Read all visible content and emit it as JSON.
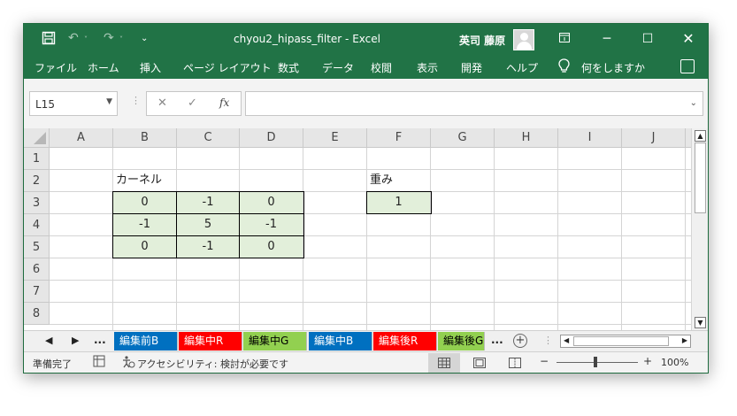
{
  "window": {
    "title": "chyou2_hipass_filter  -  Excel",
    "user": "英司 藤原",
    "accent": "#217346"
  },
  "titlebar_icons": {
    "save": "save-icon",
    "undo": "undo-icon",
    "redo": "redo-icon",
    "customize": "customize-qat-icon",
    "ribbon_display": "ribbon-display-icon",
    "minimize": "minimize-icon",
    "maximize": "maximize-icon",
    "close": "close-icon"
  },
  "menu": {
    "items": [
      "ファイル",
      "ホーム",
      "挿入",
      "ページ レイアウト",
      "数式",
      "データ",
      "校閲",
      "表示",
      "開発",
      "ヘルプ"
    ],
    "tell_me": "何をしますか"
  },
  "formula_bar": {
    "name_box": "L15",
    "cancel": "✕",
    "enter": "✓",
    "fx": "fx",
    "value": ""
  },
  "grid": {
    "columns": [
      "A",
      "B",
      "C",
      "D",
      "E",
      "F",
      "G",
      "H",
      "I",
      "J"
    ],
    "rows": [
      "1",
      "2",
      "3",
      "4",
      "5",
      "6",
      "7",
      "8"
    ],
    "kernel_label": "カーネル",
    "weight_label": "重み",
    "kernel": [
      [
        "0",
        "-1",
        "0"
      ],
      [
        "-1",
        "5",
        "-1"
      ],
      [
        "0",
        "-1",
        "0"
      ]
    ],
    "weight": "1",
    "highlight_color": "#e2efda"
  },
  "sheets": {
    "nav_prev": "◀",
    "nav_next": "▶",
    "more_left": "...",
    "more_right": "...",
    "tabs": [
      {
        "label": "編集前B",
        "color": "#0070c0",
        "text": "#ffffff"
      },
      {
        "label": "編集中R",
        "color": "#ff0000",
        "text": "#ffffff"
      },
      {
        "label": "編集中G",
        "color": "#92d050",
        "text": "#000000"
      },
      {
        "label": "編集中B",
        "color": "#0070c0",
        "text": "#ffffff"
      },
      {
        "label": "編集後R",
        "color": "#ff0000",
        "text": "#ffffff"
      },
      {
        "label": "編集後G",
        "color": "#92d050",
        "text": "#000000"
      }
    ],
    "add": "+"
  },
  "status": {
    "ready": "準備完了",
    "accessibility": "アクセシビリティ: 検討が必要です",
    "zoom_minus": "−",
    "zoom_plus": "+",
    "zoom": "100%"
  }
}
